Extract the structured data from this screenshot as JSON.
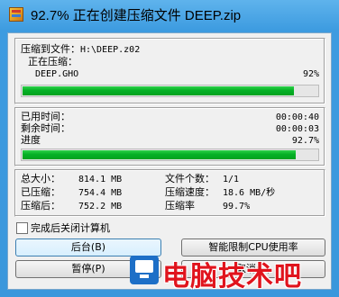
{
  "window": {
    "title": "92.7% 正在创建压缩文件 DEEP.zip"
  },
  "compress": {
    "target_label": "压缩到文件：",
    "target_path": "H:\\DEEP.z02",
    "in_progress_label": "正在压缩：",
    "current_file": "DEEP.GHO",
    "file_percent": "92%",
    "file_progress": 0.92
  },
  "time": {
    "elapsed_label": "已用时间：",
    "elapsed_value": "00:00:40",
    "remaining_label": "剩余时间：",
    "remaining_value": "00:00:03",
    "progress_label": "进度",
    "progress_percent": "92.7%",
    "total_progress": 0.927
  },
  "stats": {
    "total_size_label": "总大小：",
    "total_size_value": "814.1 MB",
    "compressed_label": "已压缩：",
    "compressed_value": "754.4 MB",
    "after_label": "压缩后：",
    "after_value": "752.2 MB",
    "file_count_label": "文件个数：",
    "file_count_value": "1/1",
    "speed_label": "压缩速度：",
    "speed_value": "18.6 MB/秒",
    "ratio_label": "压缩率",
    "ratio_value": "99.7%"
  },
  "options": {
    "shutdown_label": "完成后关闭计算机",
    "shutdown_checked": false
  },
  "buttons": {
    "background": "后台(B)",
    "limit_cpu": "智能限制CPU使用率",
    "pause": "暂停(P)",
    "cancel": "取消(C)"
  },
  "watermark": {
    "text": "电脑技术吧"
  },
  "colors": {
    "progress_green": "#06b025",
    "title_bar_blue": "#3d9be0",
    "watermark_red": "#e0141d"
  }
}
